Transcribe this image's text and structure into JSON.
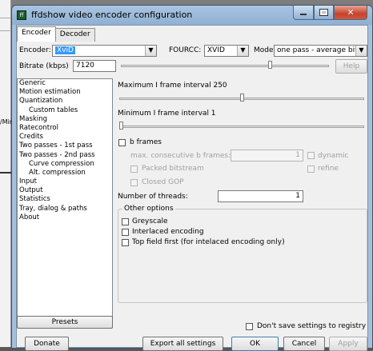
{
  "background": {
    "strip_text": "/Mir"
  },
  "window": {
    "icon_text": "ff",
    "title": "ffdshow video encoder configuration",
    "controls": {
      "minimize": "",
      "maximize": "",
      "close": "✕"
    }
  },
  "tabs": [
    {
      "label": "Encoder",
      "active": true
    },
    {
      "label": "Decoder",
      "active": false
    }
  ],
  "encoder_row": {
    "encoder_label": "Encoder:",
    "encoder_value": "XviD",
    "fourcc_label": "FOURCC:",
    "fourcc_value": "XVID",
    "mode_label": "Mode:",
    "mode_value": "one pass - average bitrate"
  },
  "bitrate_row": {
    "label": "Bitrate (kbps)",
    "value": "7120",
    "slider_level_fraction": 0.72,
    "help_label": "Help"
  },
  "nav_items": [
    {
      "label": "Generic",
      "indent": false
    },
    {
      "label": "Motion estimation",
      "indent": false
    },
    {
      "label": "Quantization",
      "indent": false
    },
    {
      "label": "Custom tables",
      "indent": true
    },
    {
      "label": "Masking",
      "indent": false
    },
    {
      "label": "Ratecontrol",
      "indent": false
    },
    {
      "label": "Credits",
      "indent": false
    },
    {
      "label": "Two passes - 1st pass",
      "indent": false
    },
    {
      "label": "Two passes - 2nd pass",
      "indent": false
    },
    {
      "label": "Curve compression",
      "indent": true
    },
    {
      "label": "Alt. compression",
      "indent": true
    },
    {
      "label": "Input",
      "indent": false
    },
    {
      "label": "Output",
      "indent": false
    },
    {
      "label": "Statistics",
      "indent": false
    },
    {
      "label": "Tray, dialog & paths",
      "indent": false
    },
    {
      "label": "About",
      "indent": false
    }
  ],
  "generic_pane": {
    "max_i_frame_label": "Maximum I frame interval 250",
    "max_i_frame_level_fraction": 0.5,
    "min_i_frame_label": "Minimum I frame interval 1",
    "min_i_frame_level_fraction": 0.0,
    "b_frames_label": "b frames",
    "max_consecutive_label": "max. consecutive b frames:",
    "max_consecutive_value": "1",
    "dynamic_label": "dynamic",
    "packed_bitstream_label": "Packed bitstream",
    "refine_label": "refine",
    "closed_gop_label": "Closed GOP",
    "threads_label": "Number of threads:",
    "threads_value": "1",
    "other_options_title": "Other options",
    "greyscale_label": "Greyscale",
    "interlaced_label": "Interlaced encoding",
    "top_field_first_label": "Top field first (for intelaced encoding only)"
  },
  "presets_label": "Presets",
  "dont_save_label": "Don't save settings to registry",
  "bottom_buttons": {
    "donate": "Donate",
    "export": "Export all settings",
    "ok": "OK",
    "cancel": "Cancel",
    "apply": "Apply"
  },
  "colors": {
    "selection": "#3399ff",
    "title_bar": "#a9c4e0",
    "close_button": "#c7432b"
  }
}
